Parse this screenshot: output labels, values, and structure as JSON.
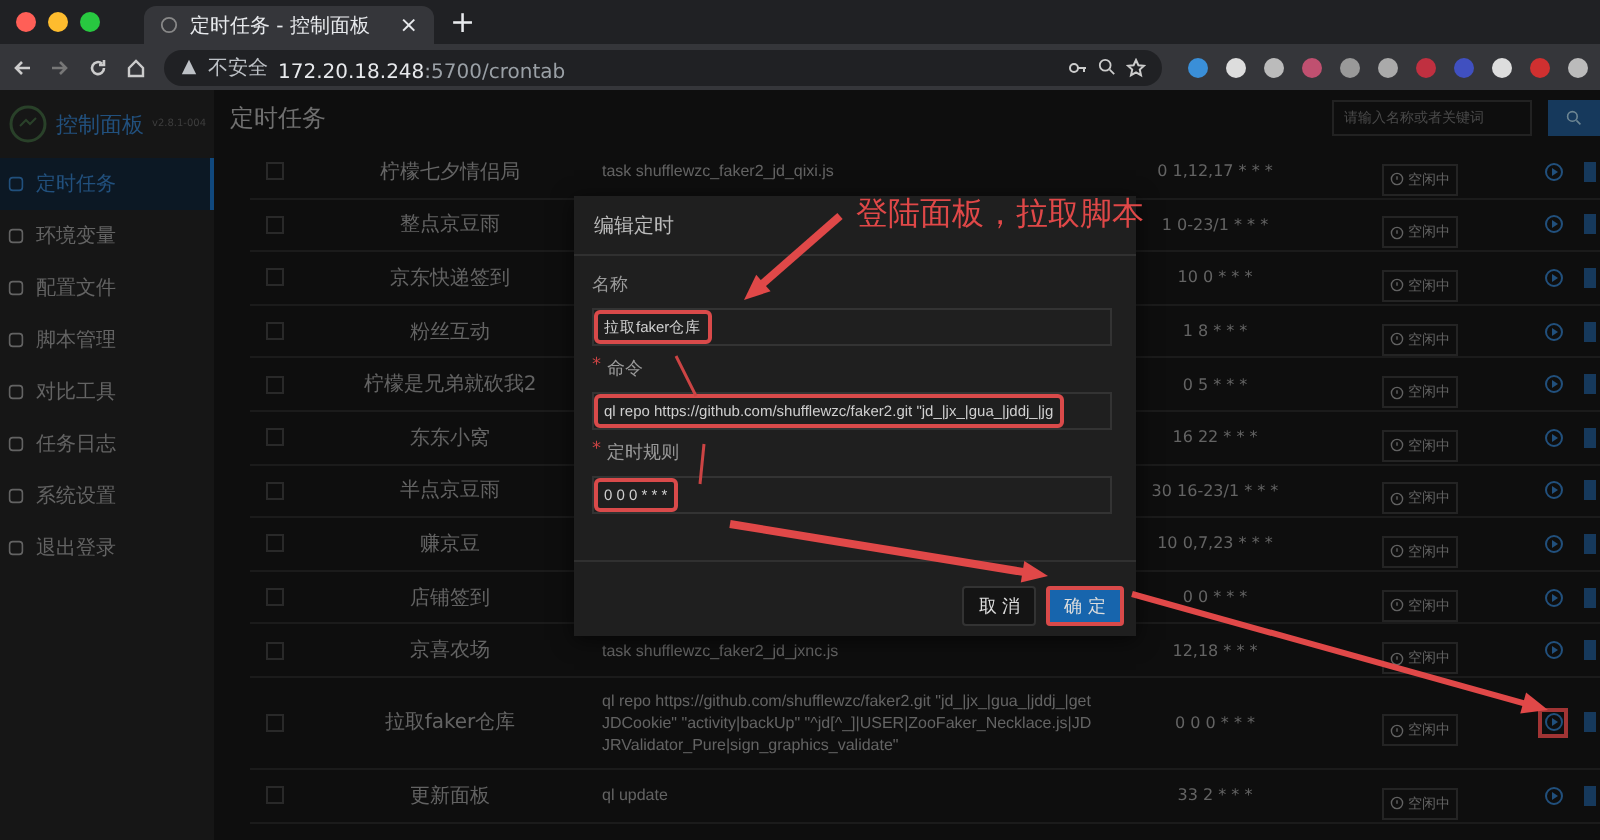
{
  "browser": {
    "tab_title": "定时任务 - 控制面板",
    "tab_close": "×",
    "new_tab": "+",
    "security": "不安全",
    "host": "172.20.18.248",
    "path": ":5700/crontab"
  },
  "app": {
    "logo": "控制面板",
    "version": "v2.8.1-004",
    "page_title": "定时任务",
    "search": {
      "placeholder": "请输入名称或者关键词"
    }
  },
  "sidebar": {
    "items": [
      {
        "label": "定时任务",
        "selected": true
      },
      {
        "label": "环境变量",
        "selected": false
      },
      {
        "label": "配置文件",
        "selected": false
      },
      {
        "label": "脚本管理",
        "selected": false
      },
      {
        "label": "对比工具",
        "selected": false
      },
      {
        "label": "任务日志",
        "selected": false
      },
      {
        "label": "系统设置",
        "selected": false
      },
      {
        "label": "退出登录",
        "selected": false
      }
    ]
  },
  "table": {
    "rows": [
      {
        "checked": false,
        "name": "柠檬七夕情侣局",
        "command": "task shufflewzc_faker2_jd_qixi.js",
        "schedule": "0 1,12,17 * * *",
        "status": "空闲中",
        "highlighted": false
      },
      {
        "checked": false,
        "name": "整点京豆雨",
        "schedule": "1 0-23/1 * * *",
        "status": "空闲中",
        "highlighted": false
      },
      {
        "checked": false,
        "name": "京东快递签到",
        "schedule": "10 0 * * *",
        "status": "空闲中",
        "highlighted": false
      },
      {
        "checked": false,
        "name": "粉丝互动",
        "schedule": "1 8 * * *",
        "status": "空闲中",
        "highlighted": false
      },
      {
        "checked": false,
        "name": "柠檬是兄弟就砍我2",
        "schedule": "0 5 * * *",
        "status": "空闲中",
        "highlighted": false
      },
      {
        "checked": false,
        "name": "东东小窝",
        "schedule": "16 22 * * *",
        "status": "空闲中",
        "highlighted": false
      },
      {
        "checked": false,
        "name": "半点京豆雨",
        "schedule": "30 16-23/1 * * *",
        "status": "空闲中",
        "highlighted": false
      },
      {
        "checked": false,
        "name": "赚京豆",
        "schedule": "10 0,7,23 * * *",
        "status": "空闲中",
        "highlighted": false
      },
      {
        "checked": false,
        "name": "店铺签到",
        "schedule": "0 0 * * *",
        "status": "空闲中",
        "highlighted": false
      },
      {
        "checked": false,
        "name": "京喜农场",
        "command": "task shufflewzc_faker2_jd_jxnc.js",
        "schedule": "12,18 * * *",
        "status": "空闲中",
        "highlighted": false
      },
      {
        "checked": false,
        "name": "拉取faker仓库",
        "command": "ql repo https://github.com/shufflewzc/faker2.git \"jd_|jx_|gua_|jddj_|getJDCookie\" \"activity|backUp\" \"^jd[^_]|USER|ZooFaker_Necklace.js|JDJRValidator_Pure|sign_graphics_validate\"",
        "schedule": "0 0 0 * * *",
        "status": "空闲中",
        "highlighted": true
      },
      {
        "checked": false,
        "name": "更新面板",
        "command": "ql update",
        "schedule": "33 2 * * *",
        "status": "空闲中",
        "highlighted": false
      }
    ]
  },
  "modal": {
    "title": "编辑定时",
    "fields": [
      {
        "label": "名称",
        "value": "拉取faker仓库",
        "highlighted": true
      },
      {
        "label": "命令",
        "required_mark": "*",
        "value": "ql repo https://github.com/shufflewzc/faker2.git \"jd_|jx_|gua_|jddj_|jg",
        "highlighted": true
      },
      {
        "label": "定时规则",
        "required_mark": "*",
        "value": "0 0 0 * * *",
        "highlighted": true
      }
    ],
    "buttons": [
      {
        "label": "取 消",
        "kind": "secondary",
        "highlighted": false
      },
      {
        "label": "确 定",
        "kind": "primary",
        "highlighted": true
      }
    ]
  },
  "annotation": {
    "text": "登陆面板，拉取脚本"
  }
}
